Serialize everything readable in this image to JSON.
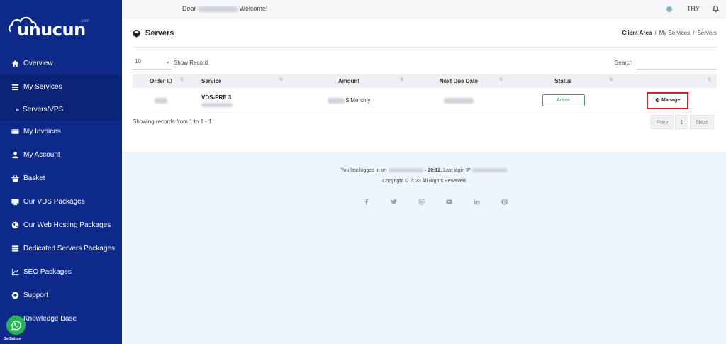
{
  "brand": {
    "name": "unucun",
    "suffix": ".com"
  },
  "sidebar": {
    "items": [
      {
        "label": "Overview",
        "icon": "home-icon"
      },
      {
        "label": "My Services",
        "icon": "list-icon"
      },
      {
        "label": "Servers/VPS",
        "icon": "chevron-right-icon"
      },
      {
        "label": "My Invoices",
        "icon": "credit-card-icon"
      },
      {
        "label": "My Account",
        "icon": "user-icon"
      },
      {
        "label": "Basket",
        "icon": "basket-icon"
      },
      {
        "label": "Our VDS Packages",
        "icon": "monitor-icon"
      },
      {
        "label": "Our Web Hosting Packages",
        "icon": "globe-icon"
      },
      {
        "label": "Dedicated Servers Packages",
        "icon": "server-icon"
      },
      {
        "label": "SEO Packages",
        "icon": "chart-icon"
      },
      {
        "label": "Support",
        "icon": "lifebuoy-icon"
      },
      {
        "label": "Knowledge Base",
        "icon": "book-icon"
      }
    ],
    "getbutton_label": "GetButton"
  },
  "topbar": {
    "greeting_prefix": "Dear",
    "greeting_suffix": "Welcome!",
    "currency": "TRY"
  },
  "page": {
    "title": "Servers",
    "breadcrumb": [
      "Client Area",
      "My Services",
      "Servers"
    ]
  },
  "table_controls": {
    "show_value": "10",
    "show_label": "Show Record",
    "search_label": "Search"
  },
  "table": {
    "headers": [
      "Order ID",
      "Service",
      "Amount",
      "Next Due Date",
      "Status",
      ""
    ],
    "rows": [
      {
        "service_name": "VDS-PRE 3",
        "amount_suffix": "$ Monthly",
        "status": "Active",
        "action": "Manage"
      }
    ]
  },
  "pagination": {
    "info": "Showing records from 1 to 1 - 1",
    "prev": "Prev",
    "page": "1",
    "next": "Next"
  },
  "footer": {
    "last_login_prefix": "You last logged in on",
    "last_login_time": "- 20:12.",
    "last_login_ip_prefix": "Last login IP",
    "copyright": "Copyright © 2023 All Rights Reserved",
    "socials": [
      "facebook-icon",
      "twitter-icon",
      "instagram-icon",
      "youtube-icon",
      "linkedin-icon",
      "pinterest-icon"
    ]
  },
  "colors": {
    "sidebar_bg": "#0d2a8a",
    "active_status": "#3ba55c",
    "manage_border": "#d32020",
    "footer_bg": "#eef6fc"
  }
}
